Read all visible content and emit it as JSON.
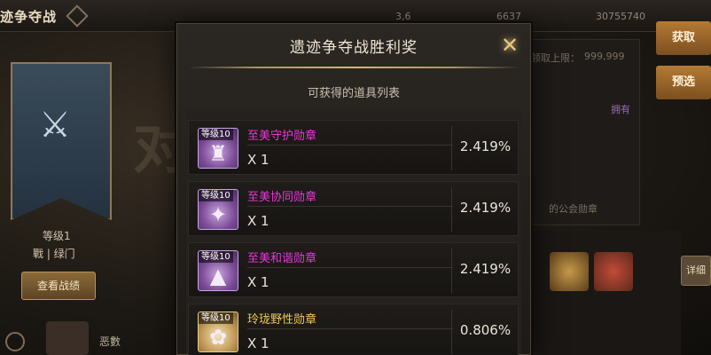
{
  "background": {
    "title": "迹争夺战",
    "stats": [
      "3,6",
      "6637",
      "30755740"
    ],
    "banner_level": "等级1",
    "banner_sub": "戰 | 绿门",
    "view_record_button": "查看战绩",
    "big_char": "对",
    "player_name": "恶數",
    "right_buttons": [
      "获取",
      "预选"
    ],
    "right_texts": [
      "领取上限：",
      "999,999",
      "拥有",
      "的公会勋章"
    ],
    "detail_button": "详细"
  },
  "modal": {
    "title": "遗迹争夺战胜利奖",
    "subtitle": "可获得的道具列表",
    "items": [
      {
        "level": "等级10",
        "name": "至美守护勋章",
        "qty": "X 1",
        "rate": "2.419%",
        "rarity": "purple",
        "glyph": "♜"
      },
      {
        "level": "等级10",
        "name": "至美协同勋章",
        "qty": "X 1",
        "rate": "2.419%",
        "rarity": "purple",
        "glyph": "✦"
      },
      {
        "level": "等级10",
        "name": "至美和谐勋章",
        "qty": "X 1",
        "rate": "2.419%",
        "rarity": "purple",
        "glyph": "▲"
      },
      {
        "level": "等级10",
        "name": "玲珑野性勋章",
        "qty": "X 1",
        "rate": "0.806%",
        "rarity": "gold",
        "glyph": "✿"
      }
    ]
  }
}
